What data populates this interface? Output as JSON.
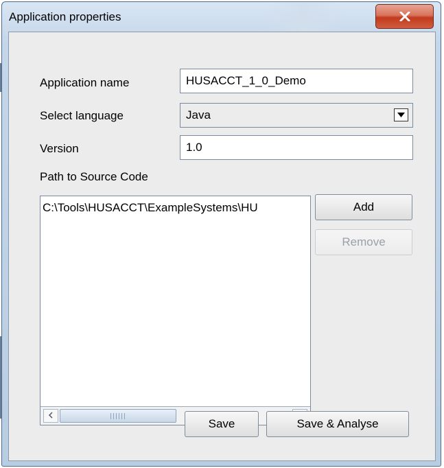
{
  "window": {
    "title": "Application properties"
  },
  "form": {
    "app_name_label": "Application name",
    "app_name_value": "HUSACCT_1_0_Demo",
    "language_label": "Select language",
    "language_value": "Java",
    "version_label": "Version",
    "version_value": "1.0",
    "path_label": "Path to Source Code"
  },
  "paths": {
    "items": [
      "C:\\Tools\\HUSACCT\\ExampleSystems\\HU"
    ]
  },
  "buttons": {
    "add_label": "Add",
    "remove_label": "Remove",
    "save_label": "Save",
    "save_analyse_label": "Save & Analyse"
  },
  "icons": {
    "close": "close-icon",
    "dropdown": "chevron-down-icon",
    "scroll_left": "chevron-left-icon",
    "scroll_right": "chevron-right-icon"
  },
  "colors": {
    "close_button": "#c23a1f",
    "window_frame": "#c4d6ea",
    "disabled_text": "#9aa0a8"
  }
}
